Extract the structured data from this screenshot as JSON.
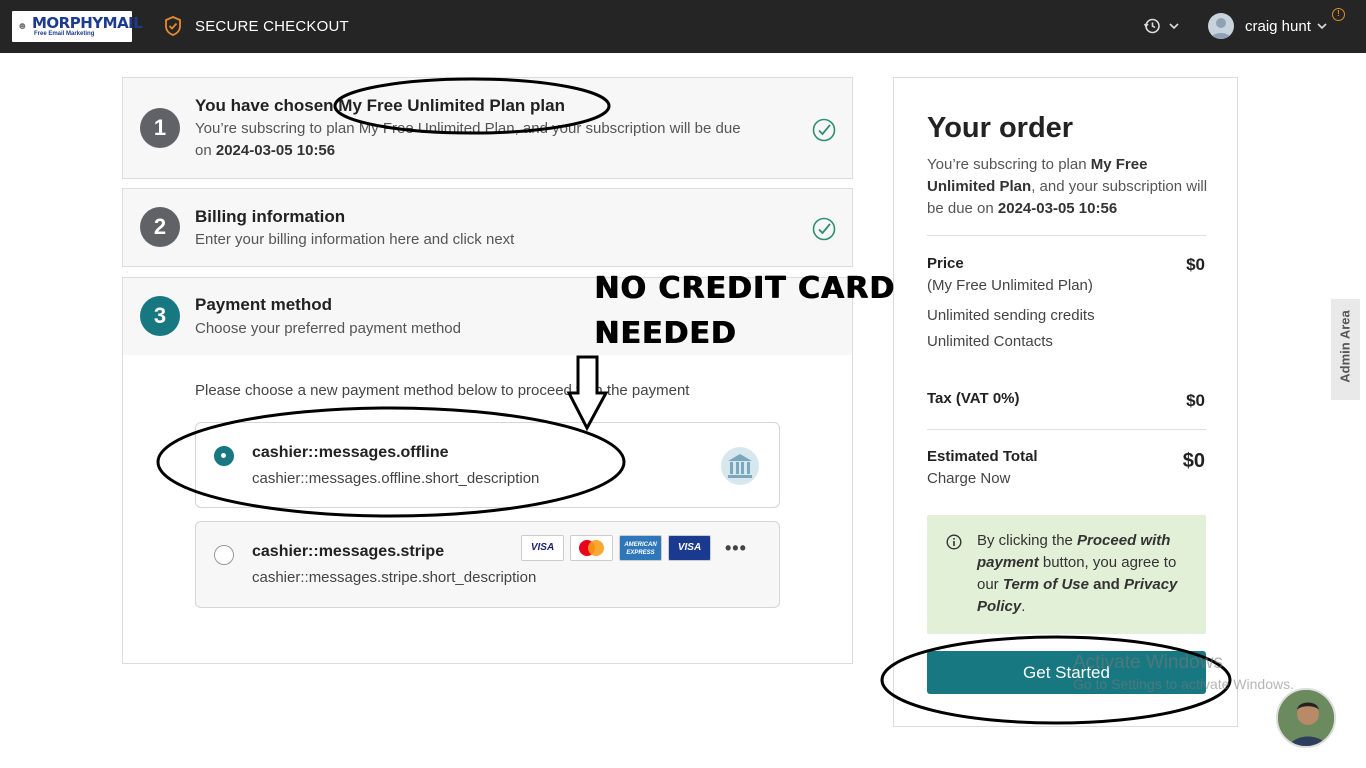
{
  "header": {
    "logo_brand": "MORPHYMAIL",
    "logo_tagline": "Free Email Marketing",
    "secure_label": "SECURE CHECKOUT",
    "user_name": "craig hunt"
  },
  "steps": [
    {
      "number": "1",
      "title": "You have chosen My Free Unlimited Plan plan",
      "sub_line1": "You’re subscring to plan My Free Unlimited Plan, and your subscription will be due",
      "sub_line2_prefix": "on ",
      "sub_line2_date": "2024-03-05 10:56",
      "completed": true
    },
    {
      "number": "2",
      "title": "Billing information",
      "subtitle": "Enter your billing information here and click next",
      "completed": true
    },
    {
      "number": "3",
      "title": "Payment method",
      "subtitle": "Choose your preferred payment method"
    }
  ],
  "payment": {
    "instruction": "Please choose a new payment method below to proceed with the payment",
    "options": [
      {
        "title": "cashier::messages.offline",
        "description": "cashier::messages.offline.short_description",
        "selected": true,
        "icon": "bank-icon"
      },
      {
        "title": "cashier::messages.stripe",
        "description": "cashier::messages.stripe.short_description",
        "selected": false,
        "cards": [
          "VISA",
          "MasterCard",
          "AMERICAN EXPRESS",
          "VISA"
        ],
        "more": "•••"
      }
    ]
  },
  "order": {
    "heading": "Your order",
    "desc_prefix": "You’re subscring to plan ",
    "desc_plan": "My Free Unlimited Plan",
    "desc_middle": ", and your subscription will be due on ",
    "desc_date": "2024-03-05 10:56",
    "price_label": "Price",
    "price_plan": "(My Free Unlimited Plan)",
    "price_value": "$0",
    "feature1": "Unlimited sending credits",
    "feature2": "Unlimited Contacts",
    "tax_label": "Tax (VAT 0%)",
    "tax_value": "$0",
    "total_label": "Estimated Total",
    "total_sub": "Charge Now",
    "total_value": "$0",
    "note_prefix": "By clicking the ",
    "note_btn": "Proceed with payment",
    "note_mid": " button, you agree to our ",
    "note_terms": "Term of Use",
    "note_and": " and ",
    "note_privacy": "Privacy Policy",
    "note_end": ".",
    "cta_label": "Get Started"
  },
  "annotation": {
    "line1": "NO CREDIT CARD",
    "line2": "NEEDED"
  },
  "side_tab": "Admin Area",
  "watermark": {
    "line1": "Activate Windows",
    "line2": "Go to Settings to activate Windows."
  },
  "colors": {
    "topbar": "#252525",
    "teal": "#187882",
    "step_grey": "#5f6368",
    "note_bg": "#e3f0d8",
    "check_green": "#2e8f74"
  }
}
